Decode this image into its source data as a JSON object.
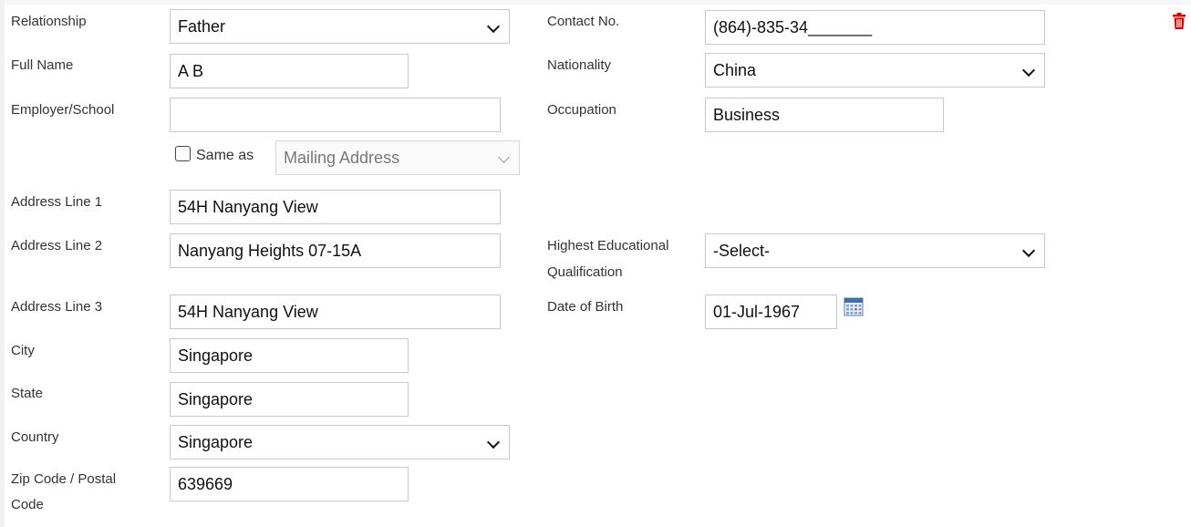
{
  "left": {
    "relationship": {
      "label": "Relationship",
      "value": "Father"
    },
    "full_name": {
      "label": "Full Name",
      "value": "A B"
    },
    "employer": {
      "label": "Employer/School",
      "value": ""
    },
    "same_as": {
      "label": "Same as",
      "value": "Mailing Address",
      "checked": false
    },
    "address1": {
      "label": "Address Line 1",
      "value": "54H Nanyang View"
    },
    "address2": {
      "label": "Address Line 2",
      "value": "Nanyang Heights 07-15A"
    },
    "address3": {
      "label": "Address Line 3",
      "value": "54H Nanyang View"
    },
    "city": {
      "label": "City",
      "value": "Singapore"
    },
    "state": {
      "label": "State",
      "value": "Singapore"
    },
    "country": {
      "label": "Country",
      "value": "Singapore"
    },
    "zip": {
      "label_line1": "Zip Code / Postal",
      "label_line2": "Code",
      "value": "639669"
    }
  },
  "right": {
    "contact": {
      "label": "Contact No.",
      "value": "(864)-835-34_______"
    },
    "nationality": {
      "label": "Nationality",
      "value": "China"
    },
    "occupation": {
      "label": "Occupation",
      "value": "Business"
    },
    "education": {
      "label_line1": "Highest Educational",
      "label_line2": "Qualification",
      "value": "-Select-"
    },
    "dob": {
      "label": "Date of Birth",
      "value": "01-Jul-1967"
    }
  },
  "icons": {
    "delete": "trash-icon",
    "calendar": "calendar-icon",
    "delete_color": "#e00000"
  }
}
